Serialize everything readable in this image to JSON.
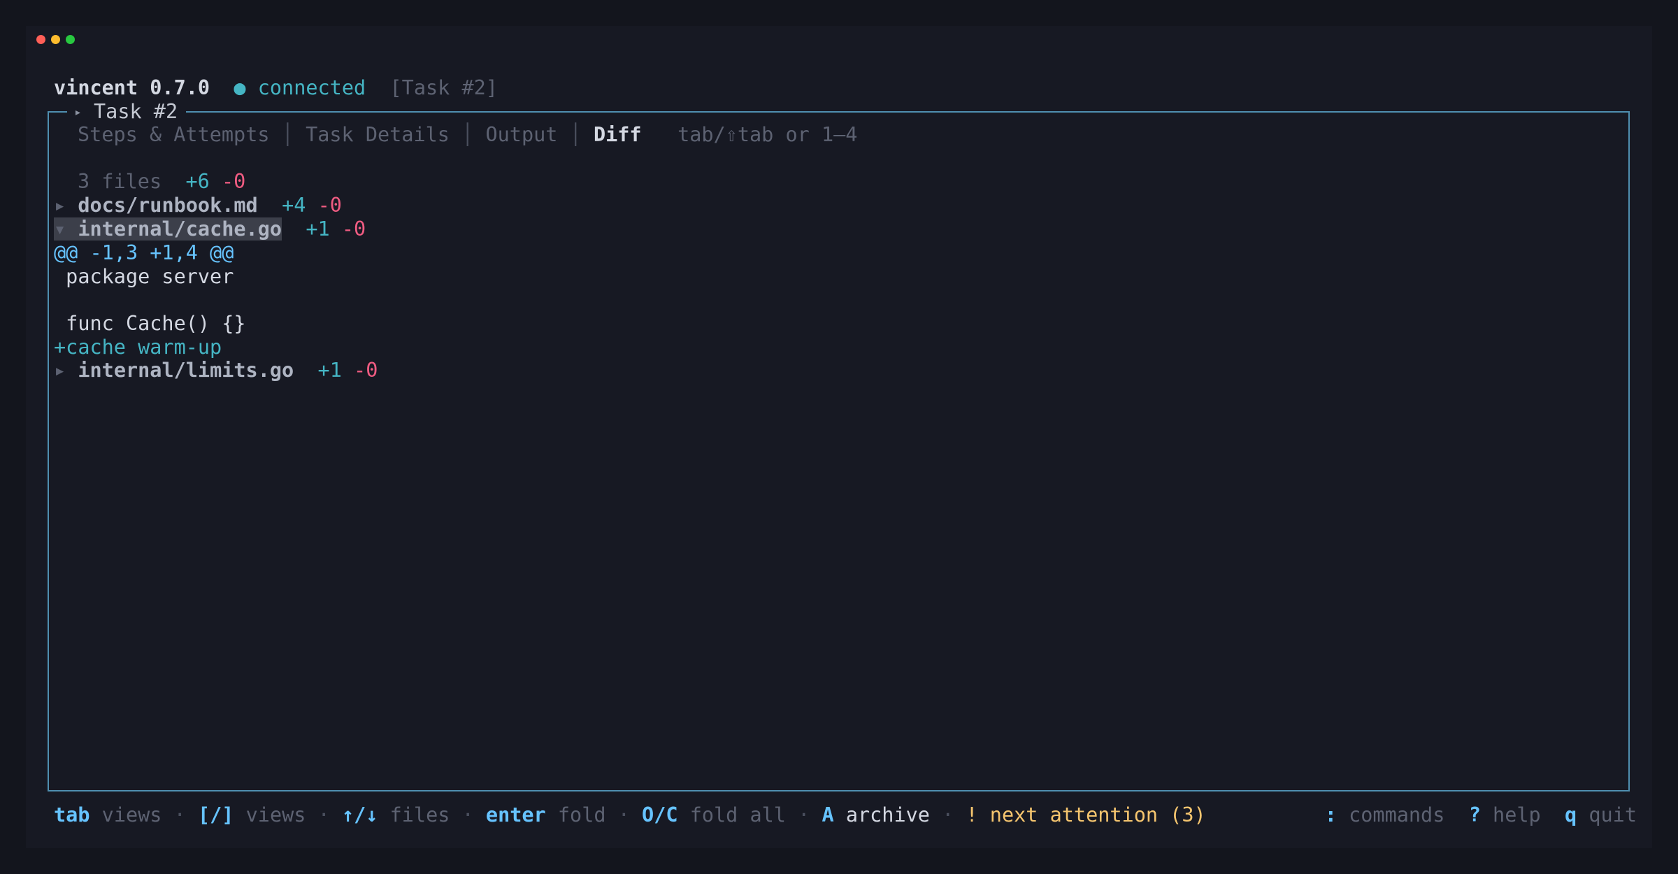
{
  "window_controls": {
    "close_color": "#ff5f57",
    "minimize_color": "#febc2e",
    "zoom_color": "#28c840"
  },
  "header": {
    "app_name": "vincent 0.7.0",
    "status_dot": "●",
    "status_text": "connected",
    "task_ref": "[Task #2]"
  },
  "panel": {
    "title_icon": "▸",
    "title": "Task #2"
  },
  "tabs": {
    "items": [
      {
        "label": "Steps & Attempts",
        "active": false
      },
      {
        "label": "Task Details",
        "active": false
      },
      {
        "label": "Output",
        "active": false
      },
      {
        "label": "Diff",
        "active": true
      }
    ],
    "separator": "│",
    "hint": "tab/⇧tab or 1–4"
  },
  "diff": {
    "summary": {
      "files": "3 files",
      "added": "+6",
      "removed": "-0"
    },
    "files": [
      {
        "arrow": "▸",
        "path": "docs/runbook.md",
        "added": "+4",
        "removed": "-0",
        "expanded": false
      },
      {
        "arrow": "▾",
        "path": "internal/cache.go",
        "added": "+1",
        "removed": "-0",
        "expanded": true,
        "selected": true
      },
      {
        "arrow": "▸",
        "path": "internal/limits.go",
        "added": "+1",
        "removed": "-0",
        "expanded": false
      }
    ],
    "hunk": {
      "header": "@@ -1,3 +1,4 @@",
      "lines": [
        {
          "kind": "context",
          "text": " package server"
        },
        {
          "kind": "context",
          "text": ""
        },
        {
          "kind": "context",
          "text": " func Cache() {}"
        },
        {
          "kind": "added",
          "text": "+cache warm-up"
        }
      ]
    }
  },
  "footer": {
    "left": [
      {
        "key": "tab",
        "desc": "views"
      },
      {
        "key": "[/]",
        "desc": "views"
      },
      {
        "key": "↑/↓",
        "desc": "files"
      },
      {
        "key": "enter",
        "desc": "fold"
      },
      {
        "key": "O/C",
        "desc": "fold all"
      },
      {
        "key": "A",
        "desc": "archive"
      },
      {
        "key": "!",
        "desc": "next attention (3)"
      }
    ],
    "dot_separator": "·",
    "right": [
      {
        "key": ":",
        "desc": "commands"
      },
      {
        "key": "?",
        "desc": "help"
      },
      {
        "key": "q",
        "desc": "quit"
      }
    ]
  }
}
